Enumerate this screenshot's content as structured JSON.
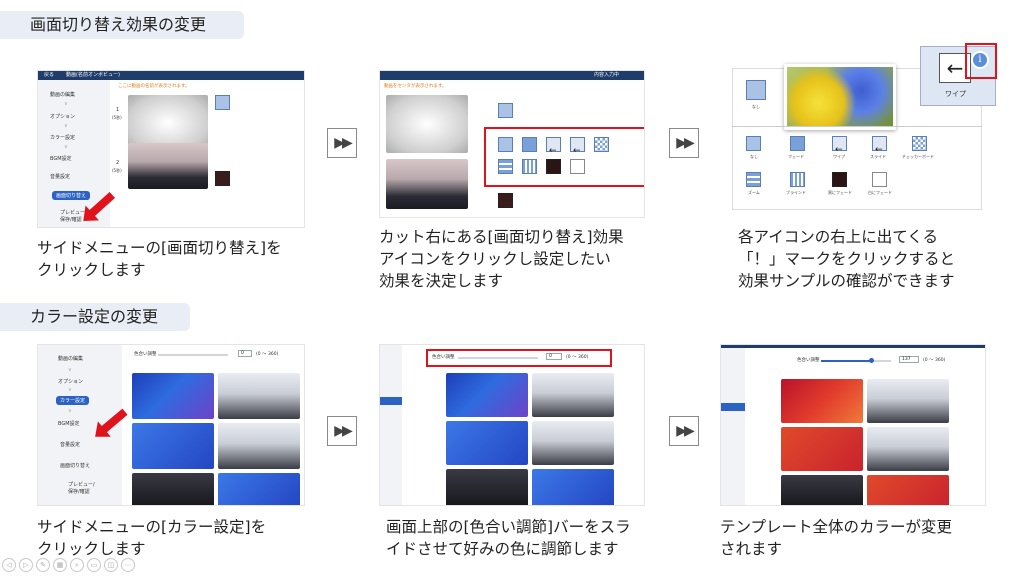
{
  "sections": {
    "transition_title": "画面切り替え効果の変更",
    "color_title": "カラー設定の変更"
  },
  "steps": {
    "s1_caption_l1": "サイドメニューの[画面切り替え]を",
    "s1_caption_l2": "クリックします",
    "s2_caption_l1": "カット右にある[画面切り替え]効果",
    "s2_caption_l2": "アイコンをクリックし設定したい",
    "s2_caption_l3": "効果を決定します",
    "s3_caption_l1": "各アイコンの右上に出てくる",
    "s3_caption_l2": "「！」マークをクリックすると",
    "s3_caption_l3": "効果サンプルの確認ができます",
    "s4_caption_l1": "サイドメニューの[カラー設定]を",
    "s4_caption_l2": "クリックします",
    "s5_caption_l1": "画面上部の[色合い調節]バーをスラ",
    "s5_caption_l2": "イドさせて好みの色に調節します",
    "s6_caption_l1": "テンプレート全体のカラーが変更",
    "s6_caption_l2": "されます"
  },
  "arrow_glyph": "▶▶",
  "app": {
    "back": "戻る",
    "title": "動画(名前オンボビュー)",
    "notice": "ここに動画の名前が表示されます。",
    "notice2": "動画をセンタが表示されます。",
    "menu": {
      "video_edit": "動画の編集",
      "option": "オプション",
      "color": "カラー設定",
      "bgm": "BGM設定",
      "voice": "音量設定",
      "transition": "画面切り替え",
      "preview": "プレビュー/",
      "preview2": "保存/確認"
    },
    "cut1": "1",
    "cut2": "2",
    "cut_sub": "(5秒)",
    "toolbar_right": "内容入力中",
    "effects": {
      "none": "なし",
      "fade": "フェード",
      "wipe": "ワイプ",
      "slide": "スライド",
      "checker": "チェッカーボード",
      "zoom": "ズーム",
      "blind": "ブラインド",
      "black_fade": "黒にフェード",
      "white_fade": "白にフェード"
    },
    "hue_label": "色合い調整",
    "hue_value_a": "0",
    "hue_value_b": "137",
    "hue_range": "(0 ～ 360)"
  },
  "colors": {
    "accent_red": "#e0121c",
    "navy": "#1f3c6a",
    "sidebar_sel": "#2b62c4"
  }
}
